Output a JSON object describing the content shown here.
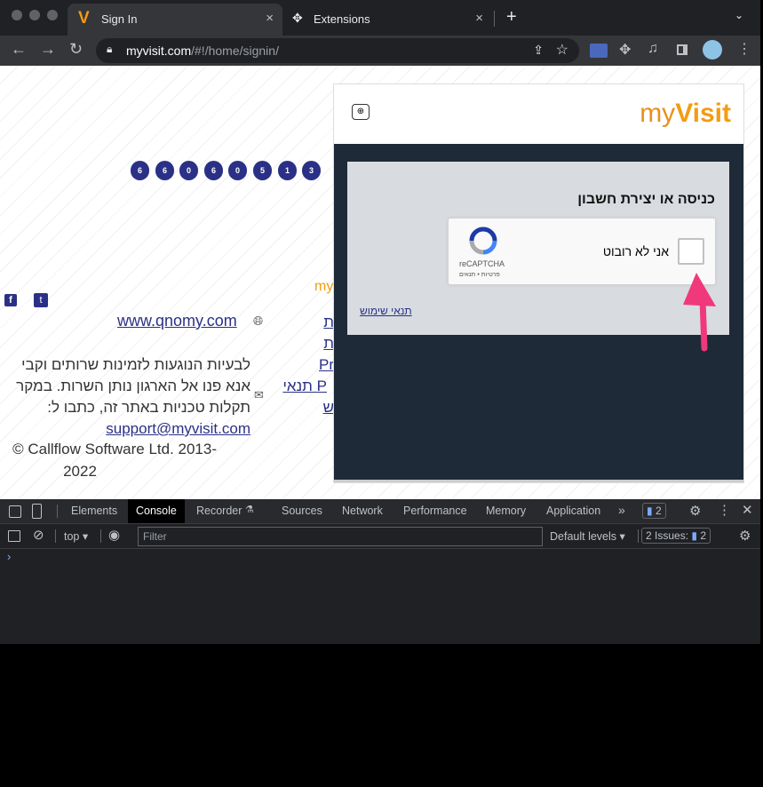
{
  "browser": {
    "tabs": [
      {
        "label": "Sign In",
        "close": "×",
        "icon": "myvisit-v-icon"
      },
      {
        "label": "Extensions",
        "close": "×",
        "icon": "puzzle-icon"
      }
    ],
    "new_tab": "+",
    "url_host": "myvisit.com",
    "url_path": "/#!/home/signin/"
  },
  "page": {
    "queue_digits": [
      "6",
      "6",
      "0",
      "6",
      "0",
      "5",
      "1",
      "3"
    ],
    "brand_partial": "my",
    "website_link": "www.qnomy.com",
    "right_col": [
      "ת",
      "ת",
      "Pr",
      "תנאי",
      "P",
      "ש"
    ],
    "contact_lines": [
      "לבעיות הנוגעות לזמינות שרותים וקבי",
      "אנא פנו אל הארגון נותן השרות. במקר",
      "תקלות טכניות באתר זה, כתבו ל:"
    ],
    "support_email": "support@myvisit.com",
    "copyright_line1": "© Callflow Software Ltd. 2013-",
    "copyright_line2": "2022"
  },
  "modal": {
    "brand_my": "my",
    "brand_visit": "Visit",
    "card_title": "כניסה או יצירת חשבון",
    "captcha_label": "אני לא רובוט",
    "captcha_brand": "reCAPTCHA",
    "captcha_sub": "פרטיות • תנאים",
    "terms_link": "תנאי שימוש"
  },
  "devtools": {
    "tabs": [
      "Elements",
      "Console",
      "Recorder",
      "Sources",
      "Network",
      "Performance",
      "Memory",
      "Application"
    ],
    "more": "»",
    "msg_count": "2",
    "context": "top",
    "filter_placeholder": "Filter",
    "levels": "Default levels",
    "issues_label": "2 Issues:",
    "issues_count": "2",
    "prompt": "›"
  },
  "colors": {
    "brand_orange": "#f39c12",
    "queue_pill": "#2b3087",
    "annotation_arrow": "#f0397a"
  }
}
